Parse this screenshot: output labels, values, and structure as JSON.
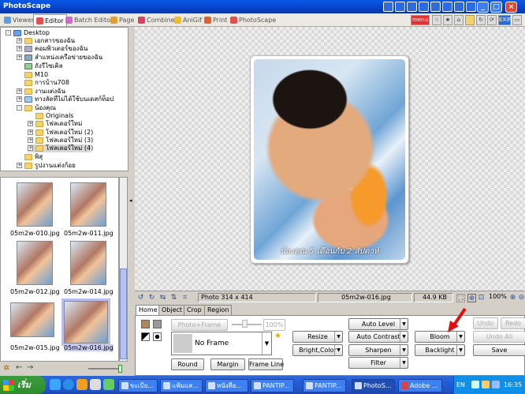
{
  "window": {
    "title": "PhotoScape"
  },
  "tabs": [
    {
      "label": "Viewer",
      "color": "#5aa0e0"
    },
    {
      "label": "Editor",
      "color": "#e05050"
    },
    {
      "label": "Batch Editor",
      "color": "#d06ad0"
    },
    {
      "label": "Page",
      "color": "#e0a030"
    },
    {
      "label": "Combine",
      "color": "#e04060"
    },
    {
      "label": "AniGif",
      "color": "#f0c020"
    },
    {
      "label": "Print",
      "color": "#e06030"
    },
    {
      "label": "PhotoScape",
      "color": "#e05050"
    }
  ],
  "toolbar_right": {
    "menu_label": "menu",
    "exif_label": "EXIF"
  },
  "tree": {
    "nodes": [
      {
        "label": "Desktop",
        "expander": "-"
      },
      {
        "label": "เอกสารของฉัน",
        "expander": "+"
      },
      {
        "label": "คอมพิวเตอร์ของฉัน",
        "expander": "+"
      },
      {
        "label": "สำแหน่งเครือข่ายของฉัน",
        "expander": "+"
      },
      {
        "label": "ถังรีไซเคิล",
        "expander": ""
      },
      {
        "label": "M10",
        "expander": ""
      },
      {
        "label": "การบ้าน708",
        "expander": ""
      },
      {
        "label": "งานแต่งฉัน",
        "expander": "+"
      },
      {
        "label": "ทางลัดที่ไม่ได้ใช้บนเดสก์ท็อป",
        "expander": "+"
      },
      {
        "label": "น้องคุณ",
        "expander": "-"
      },
      {
        "label": "Originals",
        "expander": ""
      },
      {
        "label": "โฟลเดอร์ใหม่",
        "expander": "+"
      },
      {
        "label": "โฟลเดอร์ใหม่ (2)",
        "expander": "+"
      },
      {
        "label": "โฟลเดอร์ใหม่ (3)",
        "expander": "+"
      },
      {
        "label": "โฟลเดอร์ใหม่ (4)",
        "expander": "+"
      },
      {
        "label": "พิสุ",
        "expander": ""
      },
      {
        "label": "รูปงานแต่งก้อย",
        "expander": "+"
      }
    ]
  },
  "thumbnails": [
    {
      "file": "05m2w-010.jpg"
    },
    {
      "file": "05m2w-011.jpg"
    },
    {
      "file": "05m2w-012.jpg"
    },
    {
      "file": "05m2w-014.jpg"
    },
    {
      "file": "05m2w-015.jpg"
    },
    {
      "file": "05m2w-016.jpg"
    }
  ],
  "preview": {
    "caption": "น้องคุณ 5 เดือนกับ 2 สัปดาห์"
  },
  "status": {
    "photo_info": "Photo 314 x 414",
    "filename": "05m2w-016.jpg",
    "filesize": "44.9 KB",
    "zoom": "100%"
  },
  "edit_tabs": [
    "Home",
    "Object",
    "Crop",
    "Region"
  ],
  "edit": {
    "photo_frame_label": "Photo+Frame",
    "frame_percent": "100%",
    "frame_select": "No Frame",
    "round_label": "Round",
    "margin_label": "Margin",
    "frame_line_label": "Frame Line",
    "resize_label": "Resize",
    "bright_color_label": "Bright,Color",
    "auto_level_label": "Auto Level",
    "auto_contrast_label": "Auto Contrast",
    "sharpen_label": "Sharpen",
    "filter_label": "Filter",
    "bloom_label": "Bloom",
    "backlight_label": "Backlight",
    "undo_label": "Undo",
    "redo_label": "Redo",
    "undo_all_label": "Undo All",
    "save_label": "Save"
  },
  "taskbar": {
    "start_label": "เริ่ม",
    "tasks": [
      {
        "label": "ขะเบีย..."
      },
      {
        "label": "แฟ้มแส..."
      },
      {
        "label": "หนังสือ..."
      },
      {
        "label": "PANTIP..."
      },
      {
        "label": "PANTIP..."
      },
      {
        "label": "PhotoS..."
      },
      {
        "label": "Adobe ..."
      }
    ],
    "lang": "EN",
    "clock": "16:35"
  },
  "colors": {
    "accent": "#0a5ae8",
    "arrow": "#e01010"
  }
}
